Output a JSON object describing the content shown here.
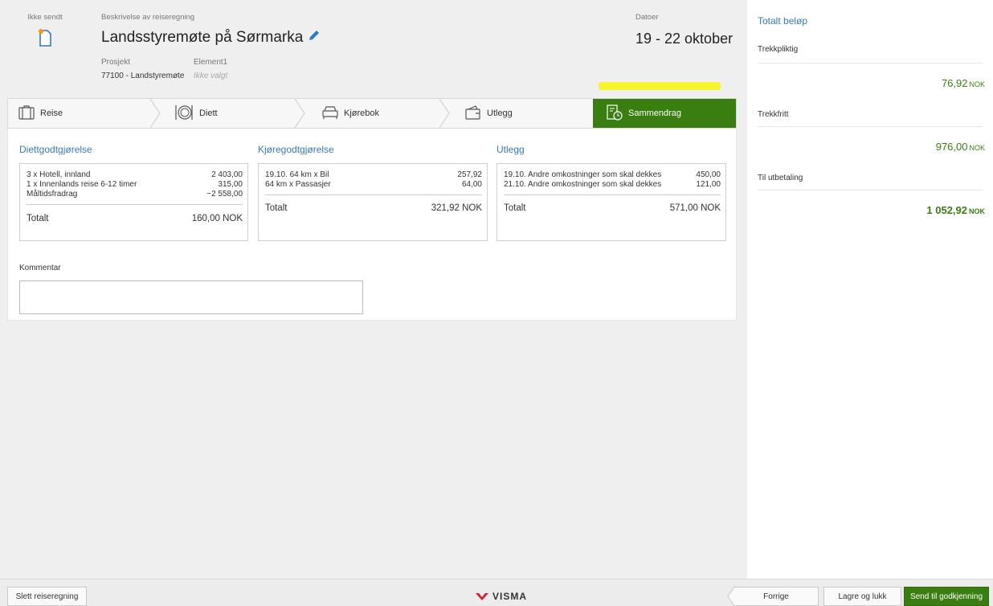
{
  "header": {
    "status_label": "Ikke sendt",
    "description_label": "Beskrivelse av reiseregning",
    "trip_title": "Landsstyremøte på Sørmarka",
    "project_label": "Prosjekt",
    "element_label": "Element1",
    "project_value": "77100 - Landstyremøte",
    "element_value": "Ikke valgt",
    "dates_label": "Datoer",
    "dates_value": "19 - 22 oktober"
  },
  "tabs": [
    {
      "label": "Reise",
      "icon": "suitcase-icon"
    },
    {
      "label": "Diett",
      "icon": "plate-icon"
    },
    {
      "label": "Kjørebok",
      "icon": "car-icon"
    },
    {
      "label": "Utlegg",
      "icon": "wallet-icon"
    },
    {
      "label": "Sammendrag",
      "icon": "summary-clock-icon",
      "active": true
    }
  ],
  "summary": {
    "diett": {
      "title": "Diettgodtgjørelse",
      "lines": [
        {
          "text": "3 x Hotell, innland",
          "amount": "2 403,00"
        },
        {
          "text": "1 x Innenlands reise 6-12 timer",
          "amount": "315,00"
        },
        {
          "text": "Måltidsfradrag",
          "amount": "−2 558,00"
        }
      ],
      "total_label": "Totalt",
      "total_value": "160,00 NOK"
    },
    "kjoring": {
      "title": "Kjøregodtgjørelse",
      "lines": [
        {
          "text": "19.10. 64 km x Bil",
          "amount": "257,92"
        },
        {
          "text": "64 km x Passasjer",
          "amount": "64,00"
        }
      ],
      "total_label": "Totalt",
      "total_value": "321,92 NOK"
    },
    "utlegg": {
      "title": "Utlegg",
      "lines": [
        {
          "text": "19.10. Andre omkostninger som skal dekkes",
          "amount": "450,00"
        },
        {
          "text": "21.10. Andre omkostninger som skal dekkes",
          "amount": "121,00"
        }
      ],
      "total_label": "Totalt",
      "total_value": "571,00 NOK"
    },
    "comment_label": "Kommentar",
    "comment_value": ""
  },
  "sidebar": {
    "title": "Totalt beløp",
    "trekkpliktig_label": "Trekkpliktig",
    "trekkpliktig_value": "76,92",
    "trekkfritt_label": "Trekkfritt",
    "trekkfritt_value": "976,00",
    "utbetaling_label": "Til utbetaling",
    "utbetaling_value": "1 052,92",
    "currency": "NOK"
  },
  "footer": {
    "delete_label": "Slett reiseregning",
    "logo_text": "VISMA",
    "prev_label": "Forrige",
    "save_close_label": "Lagre og lukk",
    "send_label": "Send til godkjenning"
  },
  "colors": {
    "accent_green": "#3a7d10",
    "link_blue": "#3a78b8",
    "highlight_yellow": "#f5f51a",
    "visma_red": "#d61c3c"
  }
}
